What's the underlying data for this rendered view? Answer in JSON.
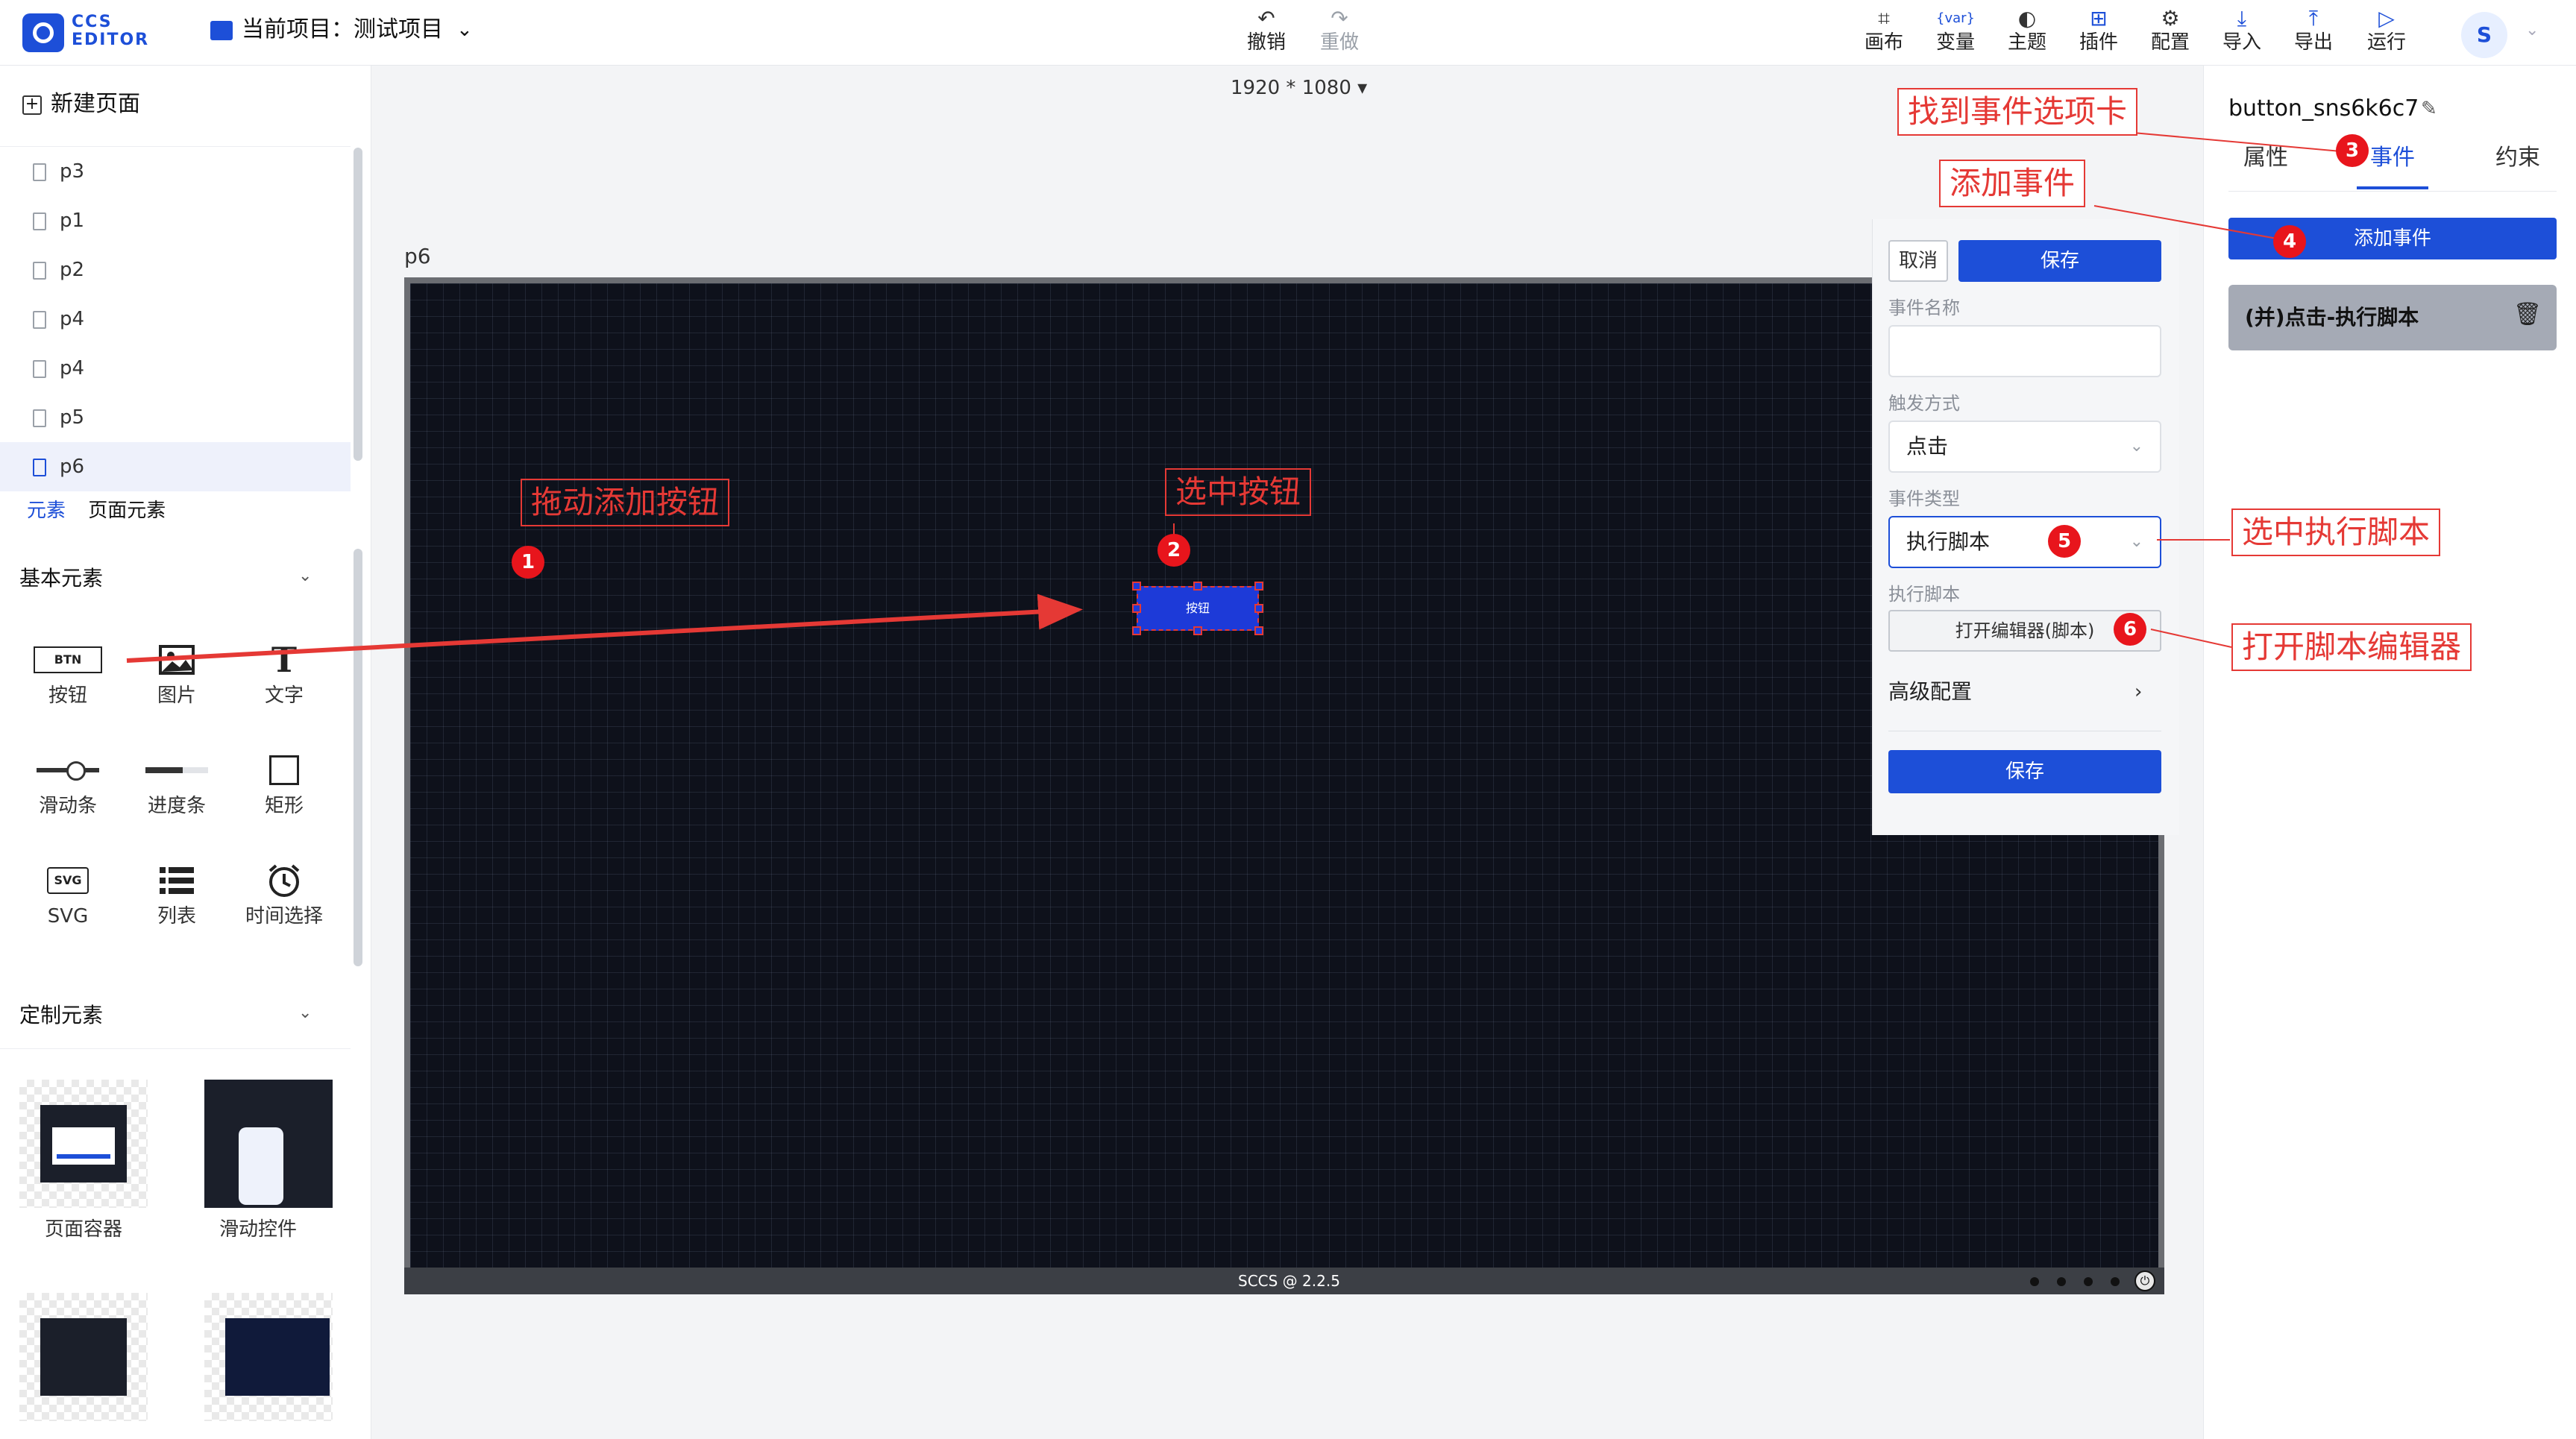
{
  "header": {
    "logo_line1": "CCS",
    "logo_line2": "EDITOR",
    "project_label": "当前项目：测试项目",
    "tools_center": [
      {
        "name": "undo",
        "label": "撤销",
        "icon": "↶",
        "disabled": false
      },
      {
        "name": "redo",
        "label": "重做",
        "icon": "↷",
        "disabled": true
      }
    ],
    "tools_right": [
      {
        "name": "canvas",
        "label": "画布",
        "icon": "⌗"
      },
      {
        "name": "variable",
        "label": "变量",
        "icon": "{var}"
      },
      {
        "name": "theme",
        "label": "主题",
        "icon": "◐"
      },
      {
        "name": "plugin",
        "label": "插件",
        "icon": "⊞"
      },
      {
        "name": "config",
        "label": "配置",
        "icon": "⚙"
      },
      {
        "name": "import",
        "label": "导入",
        "icon": "⤓"
      },
      {
        "name": "export",
        "label": "导出",
        "icon": "⤒"
      },
      {
        "name": "run",
        "label": "运行",
        "icon": "▷"
      }
    ],
    "avatar": "S"
  },
  "left": {
    "new_page": "新建页面",
    "pages": [
      "p3",
      "p1",
      "p2",
      "p4",
      "p4",
      "p5",
      "p6"
    ],
    "active_page": "p6",
    "tab_elements": "元素",
    "tab_page_elements": "页面元素",
    "basic_section": "基本元素",
    "basic_elements": [
      {
        "label": "按钮",
        "icon": "BTN"
      },
      {
        "label": "图片",
        "icon": "image-icon"
      },
      {
        "label": "文字",
        "icon": "T"
      },
      {
        "label": "滑动条",
        "icon": "slider-icon"
      },
      {
        "label": "进度条",
        "icon": "progress-icon"
      },
      {
        "label": "矩形",
        "icon": "rect-icon"
      },
      {
        "label": "SVG",
        "icon": "SVG"
      },
      {
        "label": "列表",
        "icon": "list-icon"
      },
      {
        "label": "时间选择",
        "icon": "clock-icon"
      }
    ],
    "custom_section": "定制元素",
    "custom_elements": [
      {
        "label": "页面容器"
      },
      {
        "label": "滑动控件"
      }
    ]
  },
  "canvas": {
    "resolution": "1920 * 1080",
    "page_name": "p6",
    "button_text": "按钮",
    "footer_text": "SCCS @ 2.2.5"
  },
  "event_popup": {
    "cancel": "取消",
    "save_top": "保存",
    "name_label": "事件名称",
    "name_value": "",
    "trigger_label": "触发方式",
    "trigger_value": "点击",
    "type_label": "事件类型",
    "type_value": "执行脚本",
    "script_label": "执行脚本",
    "open_editor": "打开编辑器(脚本)",
    "advanced": "高级配置",
    "save_bottom": "保存"
  },
  "right": {
    "component_id": "button_sns6k6c7",
    "tabs": [
      "属性",
      "事件",
      "约束"
    ],
    "active_tab": "事件",
    "add_event": "添加事件",
    "event_item": "(并)点击-执行脚本"
  },
  "annotations": {
    "step1": {
      "num": "1",
      "text": "拖动添加按钮"
    },
    "step2": {
      "num": "2",
      "text": "选中按钮"
    },
    "step3": {
      "num": "3",
      "text": "找到事件选项卡"
    },
    "step4": {
      "num": "4",
      "text": "添加事件"
    },
    "step5": {
      "num": "5",
      "text": "选中执行脚本"
    },
    "step6": {
      "num": "6",
      "text": "打开脚本编辑器"
    },
    "color": "#e53935"
  },
  "colors": {
    "primary": "#1d4fd8",
    "canvas_bg": "#0e111b",
    "annotation": "#e53935"
  }
}
